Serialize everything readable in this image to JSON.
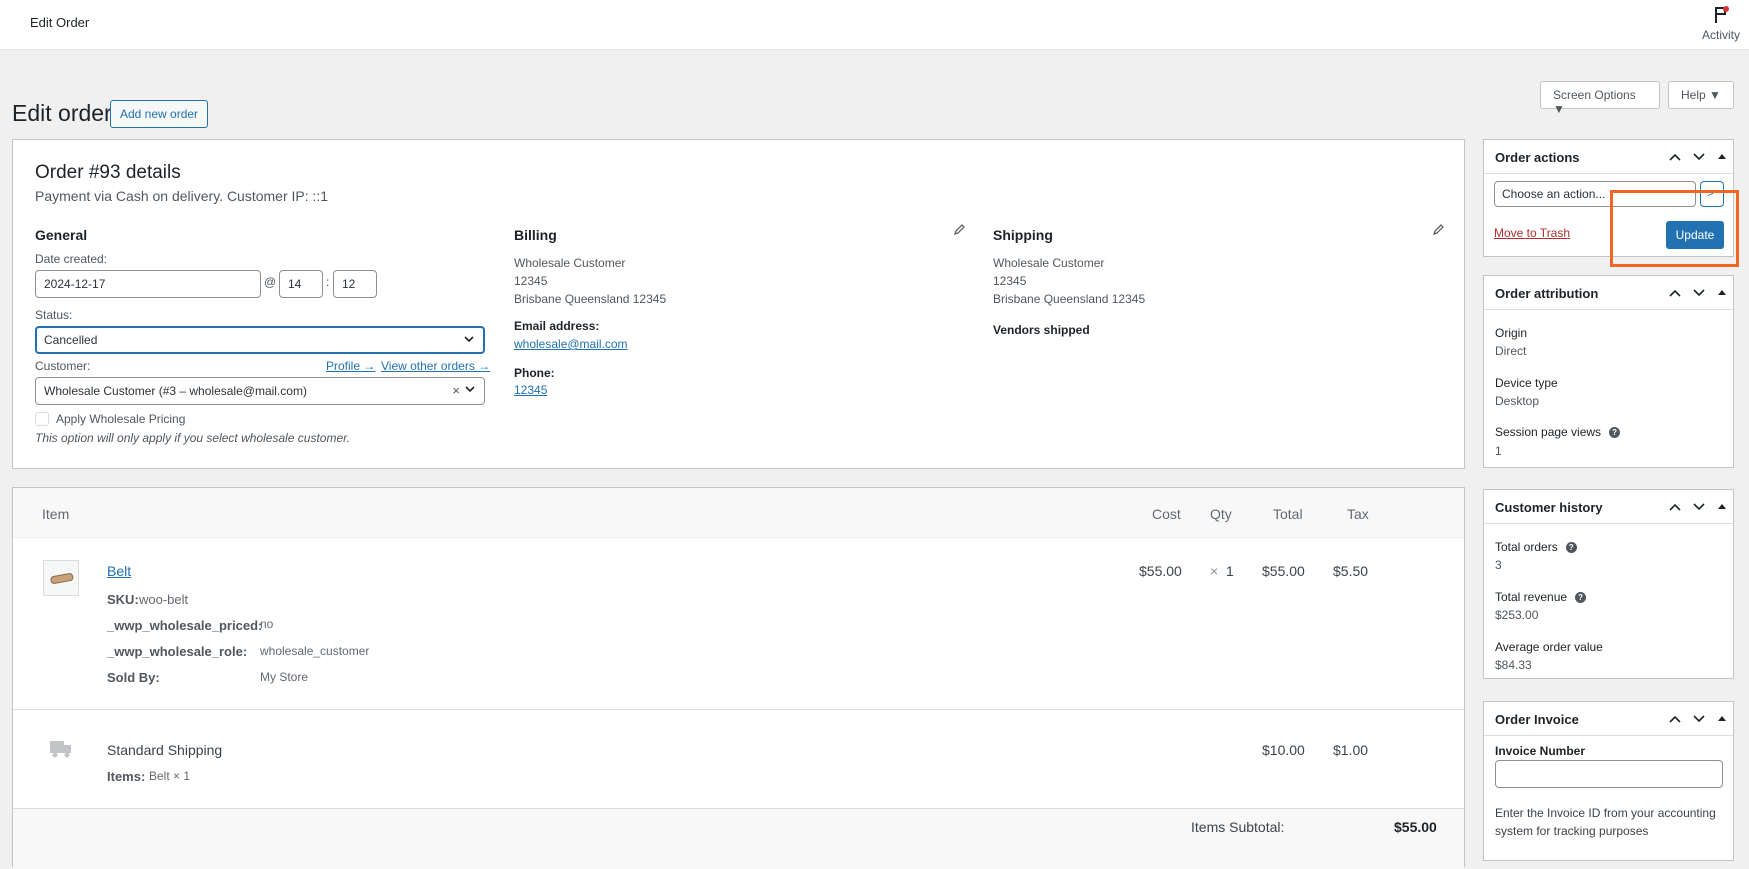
{
  "topbar": {
    "title": "Edit Order",
    "activity_label": "Activity"
  },
  "screen_options": {
    "label": "Screen Options ▼",
    "help_label": "Help ▼"
  },
  "page": {
    "title": "Edit order",
    "add_new_label": "Add new order"
  },
  "order": {
    "title": "Order #93 details",
    "subtitle": "Payment via Cash on delivery. Customer IP: ::1",
    "general": {
      "heading": "General",
      "date_label": "Date created:",
      "date_value": "2024-12-17",
      "at_sep": "@",
      "hour": "14",
      "colon": ":",
      "minute": "12",
      "status_label": "Status:",
      "status_value": "Cancelled",
      "customer_label": "Customer:",
      "profile_link": "Profile →",
      "view_orders_link": "View other orders →",
      "customer_value": "Wholesale Customer (#3 – wholesale@mail.com)",
      "clear_x": "×",
      "wholesale_checkbox_label": "Apply Wholesale Pricing",
      "wholesale_note": "This option will only apply if you select wholesale customer."
    },
    "billing": {
      "heading": "Billing",
      "line1": "Wholesale Customer",
      "line2": "12345",
      "line3": "Brisbane Queensland 12345",
      "email_label": "Email address:",
      "email": "wholesale@mail.com",
      "phone_label": "Phone:",
      "phone": "12345"
    },
    "shipping": {
      "heading": "Shipping",
      "line1": "Wholesale Customer",
      "line2": "12345",
      "line3": "Brisbane Queensland 12345",
      "vendors_label": "Vendors shipped"
    }
  },
  "items": {
    "headers": {
      "item": "Item",
      "cost": "Cost",
      "qty": "Qty",
      "total": "Total",
      "tax": "Tax"
    },
    "line": {
      "name": "Belt",
      "sku_label": "SKU:",
      "sku": "woo-belt",
      "meta1_key": "_wwp_wholesale_priced:",
      "meta1_val": "no",
      "meta2_key": "_wwp_wholesale_role:",
      "meta2_val": "wholesale_customer",
      "meta3_key": "Sold By:",
      "meta3_val": "My Store",
      "cost": "$55.00",
      "qty_x": "×",
      "qty": "1",
      "total": "$55.00",
      "tax": "$5.50"
    },
    "shipping": {
      "name": "Standard Shipping",
      "items_label": "Items:",
      "items_value": "Belt × 1",
      "total": "$10.00",
      "tax": "$1.00"
    },
    "subtotal_label": "Items Subtotal:",
    "subtotal_value": "$55.00"
  },
  "sidebar": {
    "order_actions": {
      "title": "Order actions",
      "select_value": "Choose an action...",
      "go_label": ">",
      "trash_label": "Move to Trash",
      "update_label": "Update"
    },
    "attribution": {
      "title": "Order attribution",
      "origin_label": "Origin",
      "origin_value": "Direct",
      "device_label": "Device type",
      "device_value": "Desktop",
      "views_label": "Session page views",
      "views_value": "1"
    },
    "customer_history": {
      "title": "Customer history",
      "total_orders_label": "Total orders",
      "total_orders_value": "3",
      "total_revenue_label": "Total revenue",
      "total_revenue_value": "$253.00",
      "avg_label": "Average order value",
      "avg_value": "$84.33"
    },
    "invoice": {
      "title": "Order Invoice",
      "number_label": "Invoice Number",
      "help_text_1": "Enter the Invoice ID from your accounting",
      "help_text_2": "system for tracking purposes"
    }
  },
  "colors": {
    "accent": "#2271b1",
    "highlight": "#f26522"
  }
}
